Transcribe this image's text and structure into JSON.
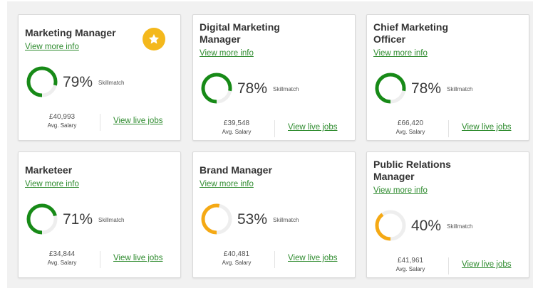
{
  "skill_suffix": "Skillmatch",
  "avg_label": "Avg. Salary",
  "more_label": "View more info",
  "jobs_label": "View live jobs",
  "colors": {
    "green": "#178a17",
    "amber": "#f5a914",
    "track": "#eeeeee",
    "link": "#2e8b2e",
    "star": "#f4b81c"
  },
  "cards": [
    {
      "title": "Marketing Manager",
      "percent": "79%",
      "match": 0.79,
      "salary": "£40,993",
      "ring_color": "green",
      "starred": true
    },
    {
      "title": "Digital Marketing Manager",
      "percent": "78%",
      "match": 0.78,
      "salary": "£39,548",
      "ring_color": "green",
      "starred": false
    },
    {
      "title": "Chief Marketing Officer",
      "percent": "78%",
      "match": 0.78,
      "salary": "£66,420",
      "ring_color": "green",
      "starred": false
    },
    {
      "title": "Marketeer",
      "percent": "71%",
      "match": 0.71,
      "salary": "£34,844",
      "ring_color": "green",
      "starred": false
    },
    {
      "title": "Brand Manager",
      "percent": "53%",
      "match": 0.53,
      "salary": "£40,481",
      "ring_color": "amber",
      "starred": false
    },
    {
      "title": "Public Relations Manager",
      "percent": "40%",
      "match": 0.4,
      "salary": "£41,961",
      "ring_color": "amber",
      "starred": false
    }
  ]
}
